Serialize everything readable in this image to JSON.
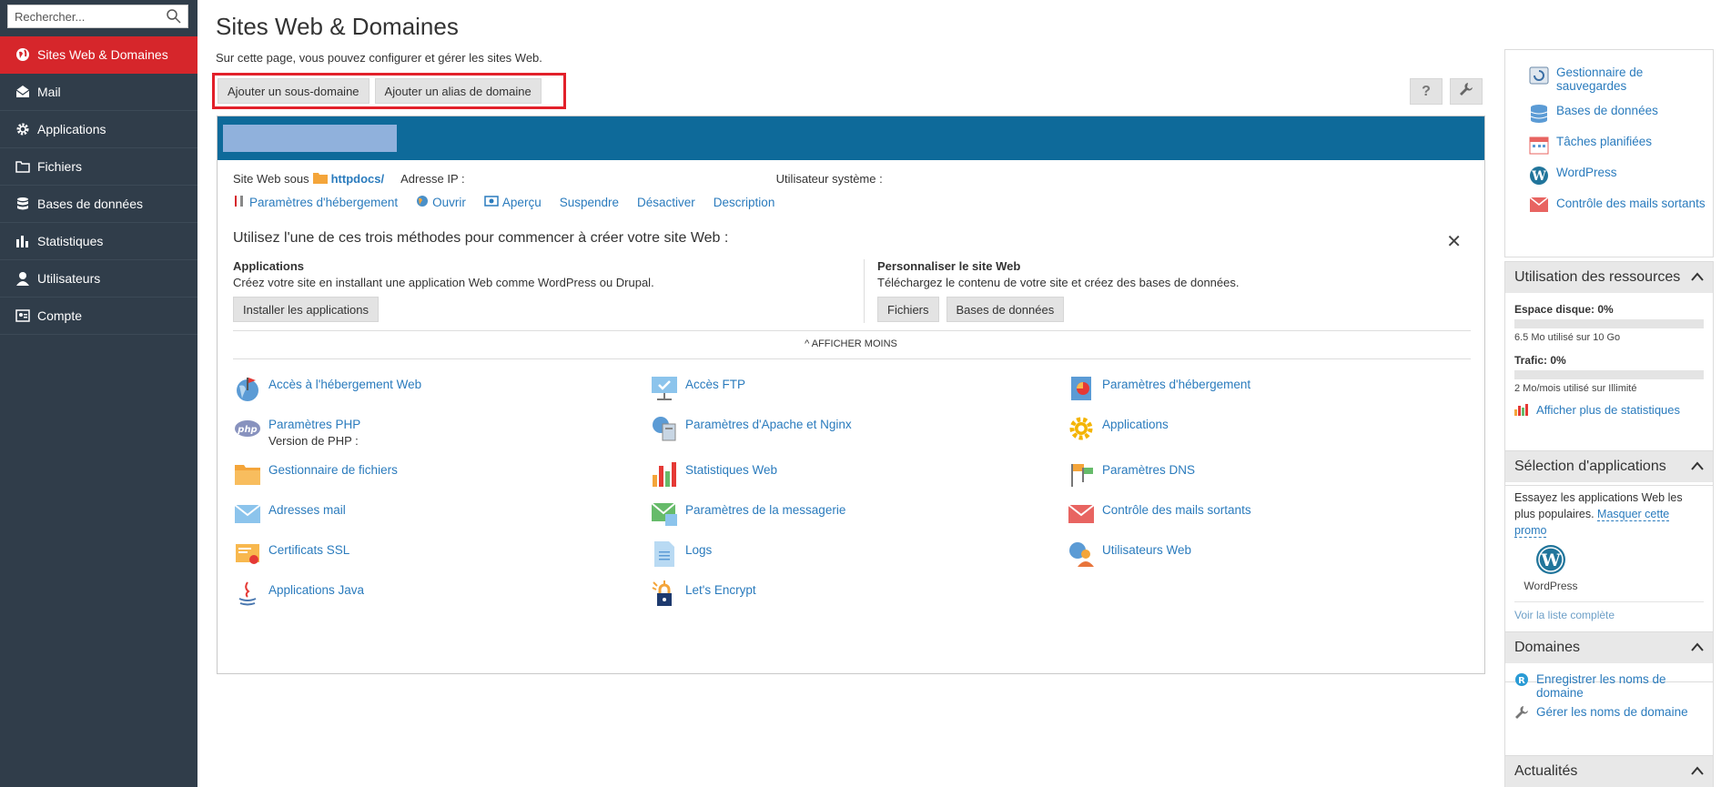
{
  "sidebar": {
    "search_placeholder": "Rechercher...",
    "items": [
      {
        "label": "Sites Web & Domaines",
        "icon": "globe-icon",
        "active": true
      },
      {
        "label": "Mail",
        "icon": "mail-icon"
      },
      {
        "label": "Applications",
        "icon": "gear-icon"
      },
      {
        "label": "Fichiers",
        "icon": "folder-icon"
      },
      {
        "label": "Bases de données",
        "icon": "database-icon"
      },
      {
        "label": "Statistiques",
        "icon": "bar-chart-icon"
      },
      {
        "label": "Utilisateurs",
        "icon": "user-icon"
      },
      {
        "label": "Compte",
        "icon": "account-icon"
      }
    ]
  },
  "page": {
    "title": "Sites Web & Domaines",
    "subtitle": "Sur cette page, vous pouvez configurer et gérer les sites Web.",
    "add_subdomain": "Ajouter un sous-domaine",
    "add_alias": "Ajouter un alias de domaine",
    "help_label": "?"
  },
  "domain": {
    "website_under": "Site Web sous",
    "folder": "httpdocs/",
    "ip_label": "Adresse IP :",
    "sys_user_label": "Utilisateur système :",
    "actions": [
      "Paramètres d'hébergement",
      "Ouvrir",
      "Aperçu",
      "Suspendre",
      "Désactiver",
      "Description"
    ]
  },
  "start": {
    "title": "Utilisez l'une de ces trois méthodes pour commencer à créer votre site Web :",
    "apps_title": "Applications",
    "apps_text": "Créez votre site en installant une application Web comme WordPress ou Drupal.",
    "apps_button": "Installer les applications",
    "custom_title": "Personnaliser le site Web",
    "custom_text": "Téléchargez le contenu de votre site et créez des bases de données.",
    "files_button": "Fichiers",
    "db_button": "Bases de données",
    "show_less": "AFFICHER MOINS"
  },
  "tools": {
    "col1": [
      "Accès à l'hébergement Web",
      "Paramètres PHP",
      "Gestionnaire de fichiers",
      "Adresses mail",
      "Certificats SSL",
      "Applications Java"
    ],
    "php_version_label": "Version de PHP :",
    "col2": [
      "Accès FTP",
      "Paramètres d'Apache et Nginx",
      "Statistiques Web",
      "Paramètres de la messagerie",
      "Logs",
      "Let's Encrypt"
    ],
    "col3": [
      "Paramètres d'hébergement",
      "Applications",
      "Paramètres DNS",
      "Contrôle des mails sortants",
      "Utilisateurs Web"
    ]
  },
  "right": {
    "links": [
      "Gestionnaire de sauvegardes",
      "Bases de données",
      "Tâches planifiées",
      "WordPress",
      "Contrôle des mails sortants"
    ],
    "resources_title": "Utilisation des ressources",
    "disk_label": "Espace disque: 0%",
    "disk_value": 0,
    "disk_detail": "6.5 Mo utilisé sur 10 Go",
    "traffic_label": "Trafic: 0%",
    "traffic_value": 0,
    "traffic_detail": "2 Mo/mois utilisé sur Illimité",
    "more_stats": "Afficher plus de statistiques",
    "apps_title": "Sélection d'applications",
    "apps_text": "Essayez les applications Web les plus populaires.",
    "apps_hide": "Masquer cette promo",
    "wp_label": "WordPress",
    "full_list": "Voir la liste complète",
    "domains_title": "Domaines",
    "register_domains": "Enregistrer les noms de domaine",
    "manage_domains": "Gérer les noms de domaine",
    "news_title": "Actualités"
  }
}
